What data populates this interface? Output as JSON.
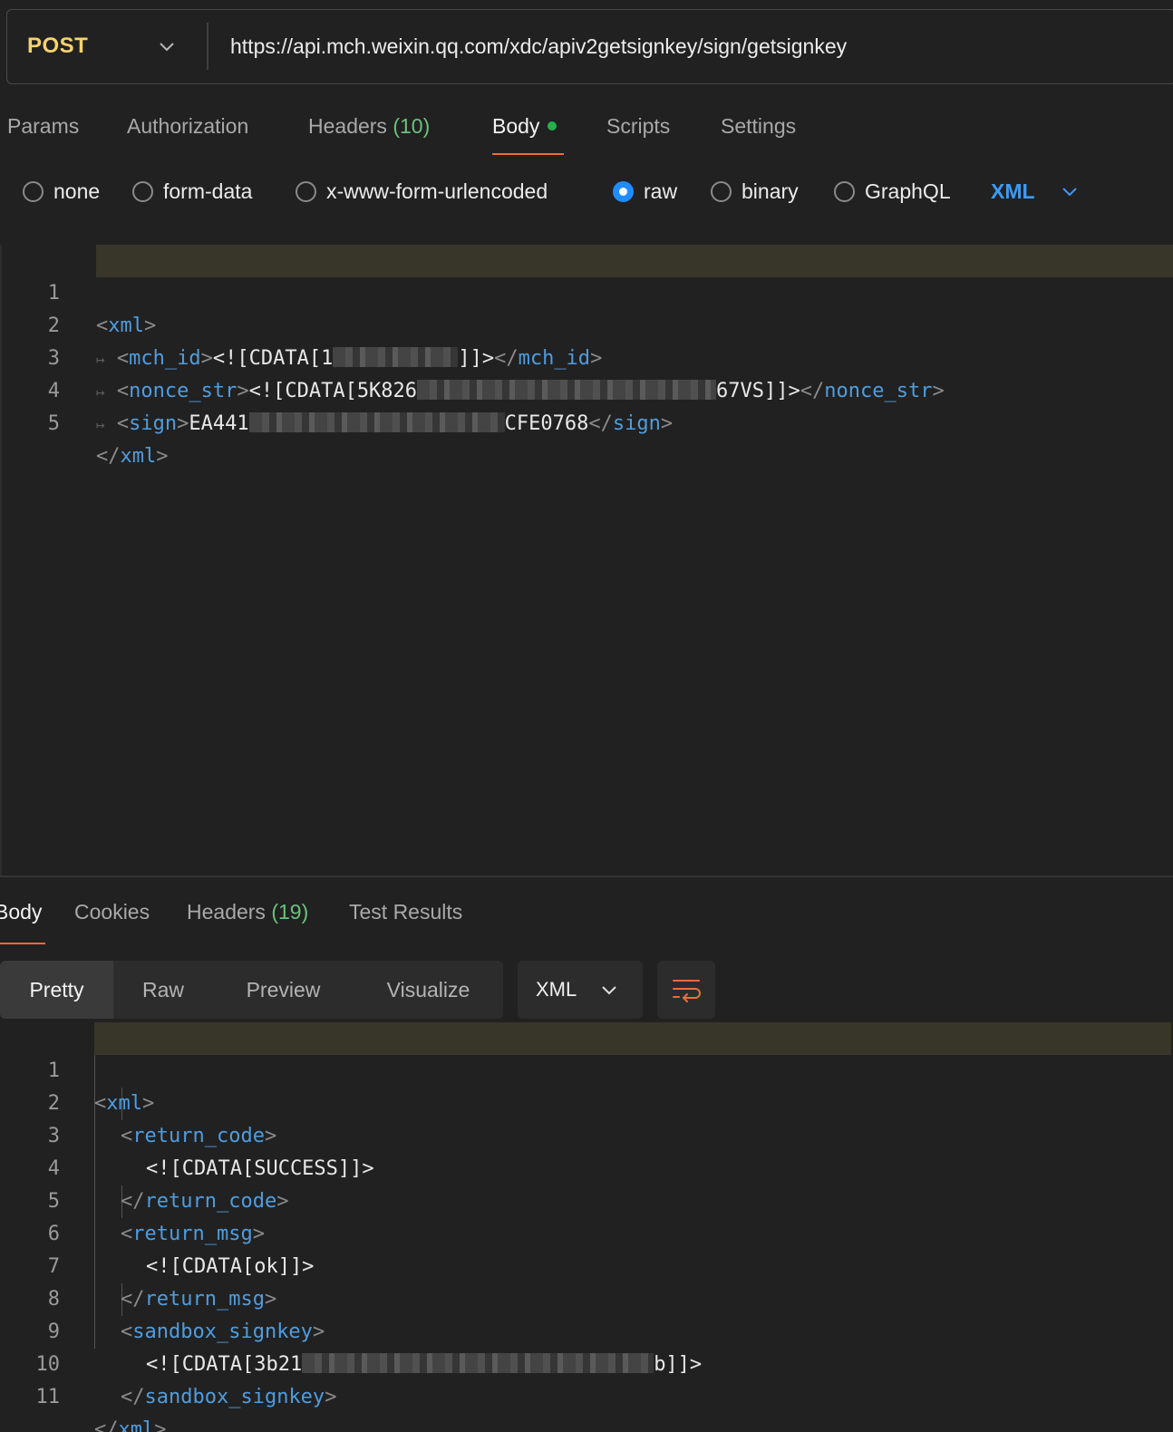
{
  "request": {
    "method": "POST",
    "url": "https://api.mch.weixin.qq.com/xdc/apiv2getsignkey/sign/getsignkey"
  },
  "request_tabs": [
    {
      "label": "Params"
    },
    {
      "label": "Authorization"
    },
    {
      "label": "Headers",
      "count": "(10)"
    },
    {
      "label": "Body"
    },
    {
      "label": "Scripts"
    },
    {
      "label": "Settings"
    }
  ],
  "body_types": [
    {
      "label": "none",
      "selected": false
    },
    {
      "label": "form-data",
      "selected": false
    },
    {
      "label": "x-www-form-urlencoded",
      "selected": false
    },
    {
      "label": "raw",
      "selected": true
    },
    {
      "label": "binary",
      "selected": false
    },
    {
      "label": "GraphQL",
      "selected": false
    }
  ],
  "body_language": "XML",
  "request_body": {
    "line_numbers": [
      "1",
      "2",
      "3",
      "4",
      "5"
    ],
    "xml_open": "xml",
    "mch_id_tag": "mch_id",
    "mch_id_prefix": "<![CDATA[1",
    "mch_id_suffix": "]]>",
    "nonce_tag": "nonce_str",
    "nonce_prefix": "<![CDATA[5K826",
    "nonce_suffix": "67VS]]>",
    "sign_tag": "sign",
    "sign_prefix": "EA441",
    "sign_suffix": "CFE0768",
    "xml_close": "xml"
  },
  "response_tabs": [
    {
      "label": "Body"
    },
    {
      "label": "Cookies"
    },
    {
      "label": "Headers",
      "count": "(19)"
    },
    {
      "label": "Test Results"
    }
  ],
  "response_views": [
    "Pretty",
    "Raw",
    "Preview",
    "Visualize"
  ],
  "response_format": "XML",
  "response_body": {
    "line_numbers": [
      "1",
      "2",
      "3",
      "4",
      "5",
      "6",
      "7",
      "8",
      "9",
      "10",
      "11"
    ],
    "xml_tag": "xml",
    "return_code_tag": "return_code",
    "return_code_value": "<![CDATA[SUCCESS]]>",
    "return_msg_tag": "return_msg",
    "return_msg_value": "<![CDATA[ok]]>",
    "sandbox_tag": "sandbox_signkey",
    "sandbox_prefix": "<![CDATA[3b21",
    "sandbox_suffix": "b]]>"
  },
  "colors": {
    "method": "#f5d36b",
    "tag": "#4e9de0",
    "accent_underline": "#ef6c3a",
    "count": "#6cc17c",
    "body_dot": "#22b14c",
    "radio_selected": "#1f8cff"
  }
}
